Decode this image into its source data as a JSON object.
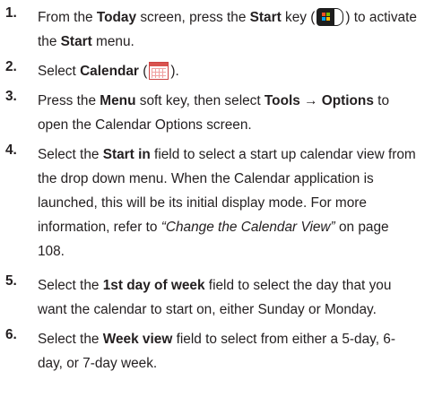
{
  "steps": [
    {
      "number": "1.",
      "parts": {
        "a": "From the ",
        "b_today": "Today",
        "c": " screen, press the ",
        "d_start": "Start",
        "e": " key (",
        "f": ") to activate the ",
        "g_start": "Start",
        "h": " menu."
      },
      "icon": "start-key-icon"
    },
    {
      "number": "2.",
      "parts": {
        "a": "Select ",
        "b_calendar": "Calendar",
        "c": " (",
        "d": ")."
      },
      "icon": "calendar-icon"
    },
    {
      "number": "3.",
      "parts": {
        "a": "Press the ",
        "b_menu": "Menu",
        "c": " soft key, then select ",
        "d_tools": "Tools → Options",
        "e": " to open the Calendar Options screen."
      }
    },
    {
      "number": "4.",
      "parts": {
        "a": "Select the ",
        "b_startin": "Start in",
        "c": " field to select a start up calendar view from the drop down menu. When the Calendar application is launched, this will be its initial display mode. For more information, refer to ",
        "d_ref": "“Change the Calendar View”",
        "e": " on page 108."
      }
    },
    {
      "number": "5.",
      "parts": {
        "a": "Select the ",
        "b_firstday": "1st day of week",
        "c": " field to select the day that you want the calendar to start on, either Sunday or Monday."
      }
    },
    {
      "number": "6.",
      "parts": {
        "a": "Select the ",
        "b_weekview": "Week view",
        "c": " field to select from either a 5-day, 6-day, or 7-day week."
      }
    }
  ]
}
